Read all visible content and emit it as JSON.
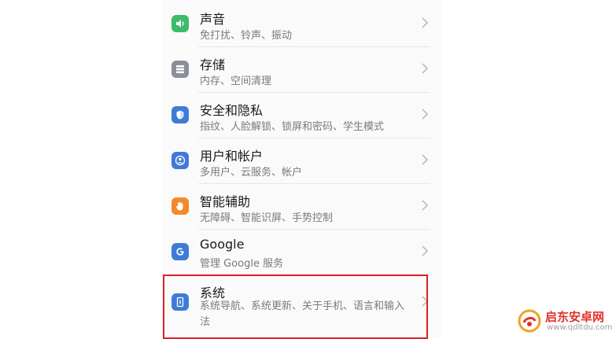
{
  "settings": {
    "items": [
      {
        "title": "声音",
        "subtitle": "免打扰、铃声、振动",
        "icon": "speaker-icon",
        "color": "#3dba6c"
      },
      {
        "title": "存储",
        "subtitle": "内存、空间清理",
        "icon": "storage-icon",
        "color": "#8a8f99"
      },
      {
        "title": "安全和隐私",
        "subtitle": "指纹、人脸解锁、锁屏和密码、学生模式",
        "icon": "shield-icon",
        "color": "#3f7bd6"
      },
      {
        "title": "用户和帐户",
        "subtitle": "多用户、云服务、帐户",
        "icon": "user-icon",
        "color": "#3f7bd6"
      },
      {
        "title": "智能辅助",
        "subtitle": "无障碍、智能识屏、手势控制",
        "icon": "hand-icon",
        "color": "#f08a2b"
      },
      {
        "title": "Google",
        "subtitle": "管理 Google 服务",
        "icon": "google-icon",
        "color": "#3f7bd6"
      },
      {
        "title": "系统",
        "subtitle": "系统导航、系统更新、关于手机、语言和输入法",
        "icon": "system-icon",
        "color": "#3f7bd6"
      }
    ]
  },
  "highlight_color": "#d8232a",
  "watermark": {
    "name": "启东安卓网",
    "url": "www.qdltdu.com"
  }
}
